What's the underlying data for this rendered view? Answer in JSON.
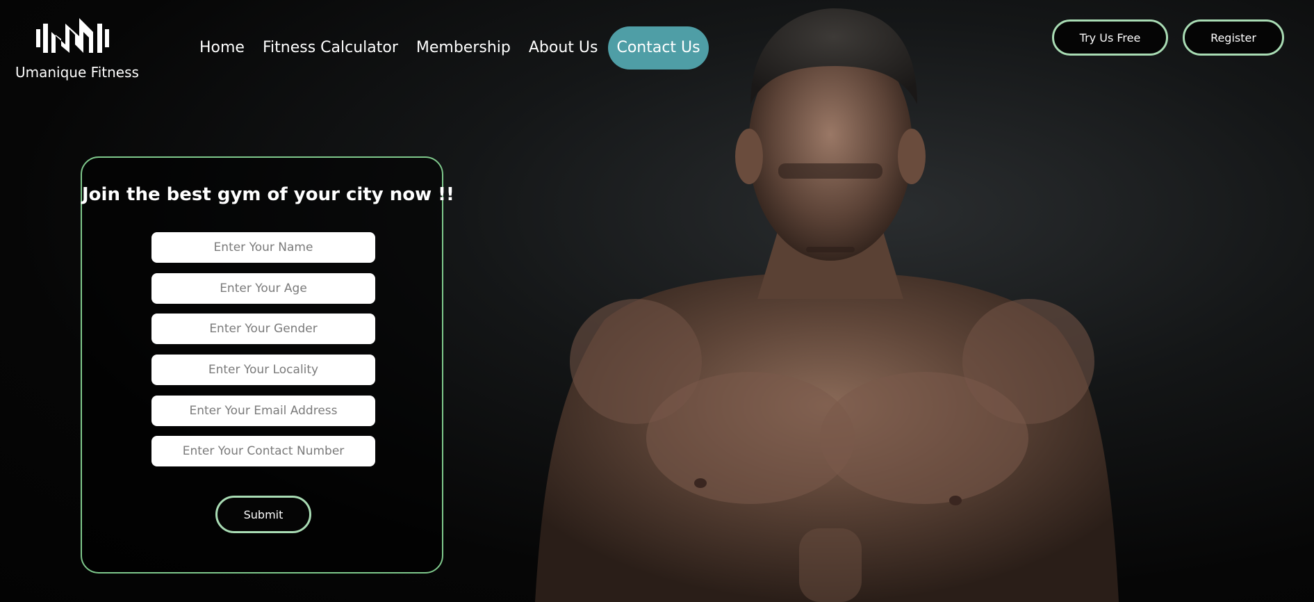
{
  "brand": {
    "name": "Umanique Fitness",
    "logo_icon": "barbell-zigzag-logo"
  },
  "nav": {
    "items": [
      {
        "label": "Home",
        "active": false
      },
      {
        "label": "Fitness Calculator",
        "active": false
      },
      {
        "label": "Membership",
        "active": false
      },
      {
        "label": "About Us",
        "active": false
      },
      {
        "label": "Contact Us",
        "active": true
      }
    ]
  },
  "header_actions": {
    "try_label": "Try Us Free",
    "register_label": "Register"
  },
  "form": {
    "title": "Join the best gym of your city now !!",
    "fields": [
      {
        "placeholder": "Enter Your Name",
        "value": ""
      },
      {
        "placeholder": "Enter Your Age",
        "value": ""
      },
      {
        "placeholder": "Enter Your Gender",
        "value": ""
      },
      {
        "placeholder": "Enter Your Locality",
        "value": ""
      },
      {
        "placeholder": "Enter Your Email Address",
        "value": ""
      },
      {
        "placeholder": "Enter Your Contact Number",
        "value": ""
      }
    ],
    "submit_label": "Submit"
  },
  "colors": {
    "accent_teal": "#4f9ea6",
    "border_green": "#7fc98c",
    "button_border": "#a9dcb4",
    "background": "#050505"
  }
}
